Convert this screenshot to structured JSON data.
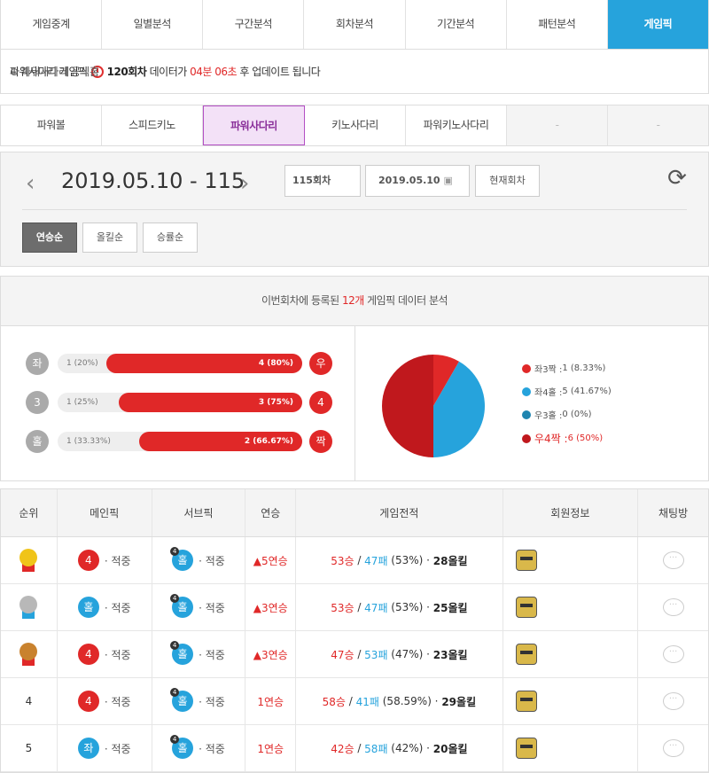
{
  "topnav": [
    "게임중계",
    "일별분석",
    "구간분석",
    "회차분석",
    "기간분석",
    "패턴분석",
    "게임픽"
  ],
  "info": {
    "title": "파워사다리 게임픽",
    "round": "120회차",
    "mid": "데이터가",
    "time": "04분 06초",
    "tail": "후 업데이트 됩니다",
    "official": "파워사다리 공식홈"
  },
  "subnav": [
    "파워볼",
    "스피드키노",
    "파워사다리",
    "키노사다리",
    "파워키노사다리",
    "-",
    "-"
  ],
  "date": {
    "title": "2019.05.10 - 115",
    "round_input": "115회차",
    "date_input": "2019.05.10",
    "current_btn": "현재회차"
  },
  "sort": [
    "연승순",
    "올킬순",
    "승률순"
  ],
  "analysis": {
    "pre": "이번회차에 등록된",
    "count": "12개",
    "post": "게임픽 데이터 분석"
  },
  "bars": [
    {
      "l": "좌",
      "r": "우",
      "lt": "1 (20%)",
      "rt": "4 (80%)",
      "pct": 0.8
    },
    {
      "l": "3",
      "r": "4",
      "lt": "1 (25%)",
      "rt": "3 (75%)",
      "pct": 0.75
    },
    {
      "l": "홀",
      "r": "짝",
      "lt": "1 (33.33%)",
      "rt": "2 (66.67%)",
      "pct": 0.6667
    }
  ],
  "chart_data": {
    "type": "pie",
    "categories": [
      "좌3짝",
      "좌4홀",
      "우3홀",
      "우4짝"
    ],
    "values": [
      1,
      5,
      0,
      6
    ],
    "labels": [
      "1 (8.33%)",
      "5 (41.67%)",
      "0 (0%)",
      "6 (50%)"
    ],
    "colors": [
      "#e02828",
      "#26a3dc",
      "#1f85b0",
      "#c0181d"
    ]
  },
  "thead": [
    "순위",
    "메인픽",
    "서브픽",
    "연승",
    "게임전적",
    "회원정보",
    "채팅방"
  ],
  "rows": [
    {
      "rank": "",
      "medal": "gold",
      "main": "4",
      "mainc": "r",
      "hit": "· 적중",
      "sub": "홀",
      "streak": "▲5연승",
      "w": "53승",
      "l": "47패",
      "p": "(53%)",
      "k": "28올킬"
    },
    {
      "rank": "",
      "medal": "silver",
      "main": "홀",
      "mainc": "b",
      "hit": "· 적중",
      "sub": "홀",
      "streak": "▲3연승",
      "w": "53승",
      "l": "47패",
      "p": "(53%)",
      "k": "25올킬"
    },
    {
      "rank": "",
      "medal": "bronze",
      "main": "4",
      "mainc": "r",
      "hit": "· 적중",
      "sub": "홀",
      "streak": "▲3연승",
      "w": "47승",
      "l": "53패",
      "p": "(47%)",
      "k": "23올킬"
    },
    {
      "rank": "4",
      "medal": "",
      "main": "4",
      "mainc": "r",
      "hit": "· 적중",
      "sub": "홀",
      "streak": "1연승",
      "w": "58승",
      "l": "41패",
      "p": "(58.59%)",
      "k": "29올킬"
    },
    {
      "rank": "5",
      "medal": "",
      "main": "좌",
      "mainc": "b",
      "hit": "· 적중",
      "sub": "홀",
      "streak": "1연승",
      "w": "42승",
      "l": "58패",
      "p": "(42%)",
      "k": "20올킬"
    }
  ]
}
